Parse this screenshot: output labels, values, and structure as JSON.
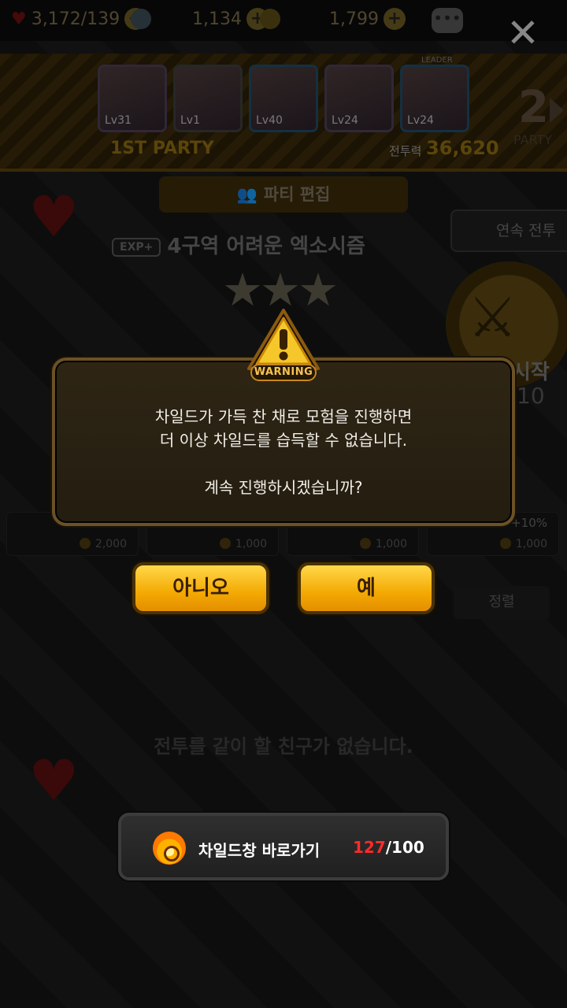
{
  "resources": {
    "stamina_value": "3,172",
    "stamina_max": "/139",
    "gem_value": "1,134",
    "gold_value": "1,799"
  },
  "party": {
    "members": [
      {
        "level": "Lv31"
      },
      {
        "level": "Lv1"
      },
      {
        "level": "Lv40"
      },
      {
        "level": "Lv24"
      },
      {
        "level": "Lv24",
        "tag": "LEADER"
      }
    ],
    "party_label": "1ST PARTY",
    "power_label": "전투력",
    "power_value": "36,620",
    "party_number": "2",
    "party_number_label": "PARTY"
  },
  "edit_button_label": "파티 편집",
  "continuous_battle_label": "연속 전투",
  "stage": {
    "exp_badge": "EXP+",
    "title": "4구역 어려운 엑소시즘",
    "stars": "★★★"
  },
  "start": {
    "label": "시작",
    "cost": "10"
  },
  "bonus_cards": [
    {
      "cost": "2,000",
      "bonus": ""
    },
    {
      "cost": "1,000",
      "bonus": ""
    },
    {
      "cost": "1,000",
      "bonus": ""
    },
    {
      "cost": "1,000",
      "bonus": "+10%"
    }
  ],
  "sort_label": "정렬",
  "no_friend_text": "전투를 같이 할 친구가 없습니다.",
  "warning": {
    "badge_label": "WARNING",
    "line1": "차일드가 가득 찬 채로 모험을 진행하면",
    "line2": "더 이상 차일드를 습득할 수 없습니다.",
    "line3": "계속 진행하시겠습니까?",
    "no_label": "아니오",
    "yes_label": "예"
  },
  "child_shortcut": {
    "label": "차일드창 바로가기",
    "current": "127",
    "max": "/100"
  },
  "colors": {
    "accent": "#f4a902",
    "danger": "#ff2a2a"
  }
}
